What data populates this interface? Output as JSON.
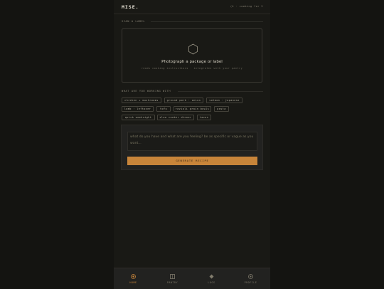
{
  "app": {
    "logo": "MISE.",
    "cooking_for": "(4 · cooking for 2"
  },
  "scan": {
    "section_label": "SCAN A LABEL",
    "title": "Photograph a package or label",
    "subtitle": "reads cooking instructions · integrates with your pantry"
  },
  "ingredients": {
    "section_label": "WHAT ARE YOU WORKING WITH",
    "chips": [
      "chicken + mushrooms",
      "ground pork · onion",
      "salmon · japanese",
      "lamb · leftover",
      "tofu",
      "ravioli grain bowls",
      "pasta",
      "quick weeknight",
      "slow cooker dinner",
      "tacos"
    ]
  },
  "prompt": {
    "placeholder": "what do you have and what are you feeling? be as specific or vague as you want...",
    "generate_label": "GENERATE RECIPE"
  },
  "nav": {
    "tabs": [
      {
        "label": "HOME",
        "icon": "home-icon",
        "active": true
      },
      {
        "label": "PANTRY",
        "icon": "pantry-icon",
        "active": false
      },
      {
        "label": "LOGS",
        "icon": "logs-icon",
        "active": false
      },
      {
        "label": "PROFILE",
        "icon": "profile-icon",
        "active": false
      }
    ]
  },
  "colors": {
    "accent": "#c8853a",
    "background": "#141411",
    "surface": "#191915"
  }
}
